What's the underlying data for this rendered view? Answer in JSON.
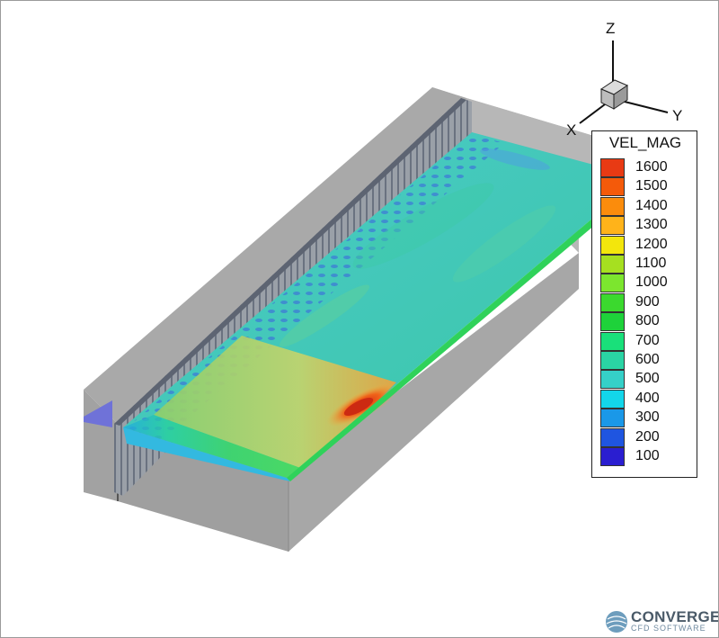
{
  "legend": {
    "title": "VEL_MAG",
    "levels": [
      {
        "label": "1600",
        "color": "#e83a14"
      },
      {
        "label": "1500",
        "color": "#f45a0a"
      },
      {
        "label": "1400",
        "color": "#fb8c0c"
      },
      {
        "label": "1300",
        "color": "#ffb31a"
      },
      {
        "label": "1200",
        "color": "#f3e60c"
      },
      {
        "label": "1100",
        "color": "#a6e020"
      },
      {
        "label": "1000",
        "color": "#7ce62e"
      },
      {
        "label": "900",
        "color": "#3bd92e"
      },
      {
        "label": "800",
        "color": "#1ed23a"
      },
      {
        "label": "700",
        "color": "#19e07a"
      },
      {
        "label": "600",
        "color": "#2ad4a4"
      },
      {
        "label": "500",
        "color": "#35d0c8"
      },
      {
        "label": "400",
        "color": "#13d6ea"
      },
      {
        "label": "300",
        "color": "#1a98e8"
      },
      {
        "label": "200",
        "color": "#1f55e0"
      },
      {
        "label": "100",
        "color": "#2a1ed0"
      }
    ]
  },
  "axes": {
    "x": "X",
    "y": "Y",
    "z": "Z"
  },
  "logo": {
    "name": "CONVERGE",
    "subtitle": "CFD SOFTWARE"
  },
  "colors": {
    "housing": "#a7a7a7",
    "housing_dark": "#8e8e8e",
    "housing_light": "#b9b9b9",
    "fins": "#7e8692"
  }
}
